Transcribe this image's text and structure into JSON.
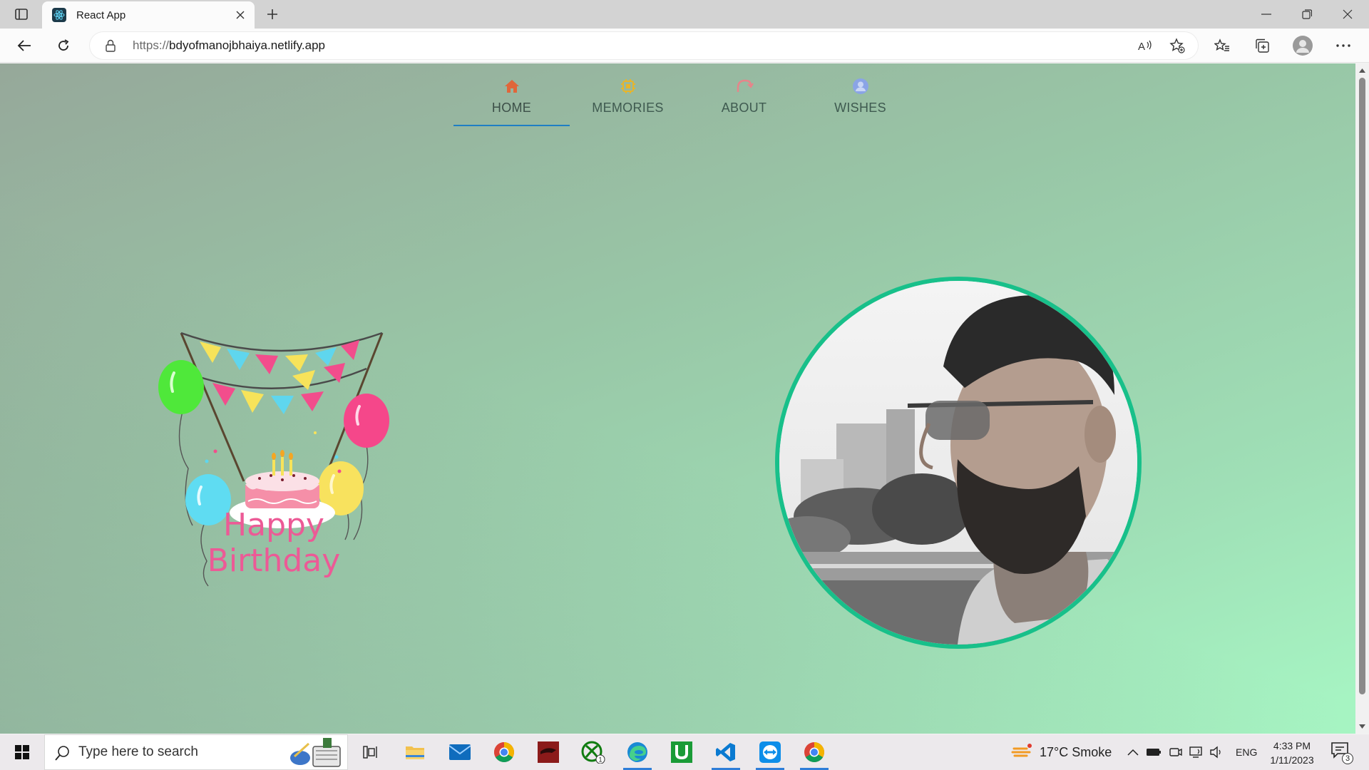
{
  "browser": {
    "tab_title": "React App",
    "url_protocol": "https://",
    "url_host": "bdyofmanojbhaiya.netlify.app"
  },
  "nav": {
    "items": [
      {
        "label": "HOME",
        "icon": "home-icon",
        "color": "#e0663a",
        "active": true
      },
      {
        "label": "MEMORIES",
        "icon": "memories-icon",
        "color": "#e8b52a",
        "active": false
      },
      {
        "label": "ABOUT",
        "icon": "about-icon",
        "color": "#e7848a",
        "active": false
      },
      {
        "label": "WISHES",
        "icon": "wishes-icon",
        "color": "#8aa4e6",
        "active": false
      }
    ]
  },
  "hero": {
    "greeting_line1": "Happy",
    "greeting_line2": "Birthday",
    "portrait_alt": "person-photo",
    "ring_color": "#18c08a"
  },
  "taskbar": {
    "search_placeholder": "Type here to search",
    "weather": "17°C  Smoke",
    "language": "ENG",
    "time": "4:33 PM",
    "date": "1/11/2023",
    "notification_count": "3",
    "xbox_badge": "1"
  },
  "colors": {
    "accent_underline": "#1f7fc4",
    "page_gradient_start": "#96a89a",
    "page_gradient_end": "#a7f7c4"
  }
}
